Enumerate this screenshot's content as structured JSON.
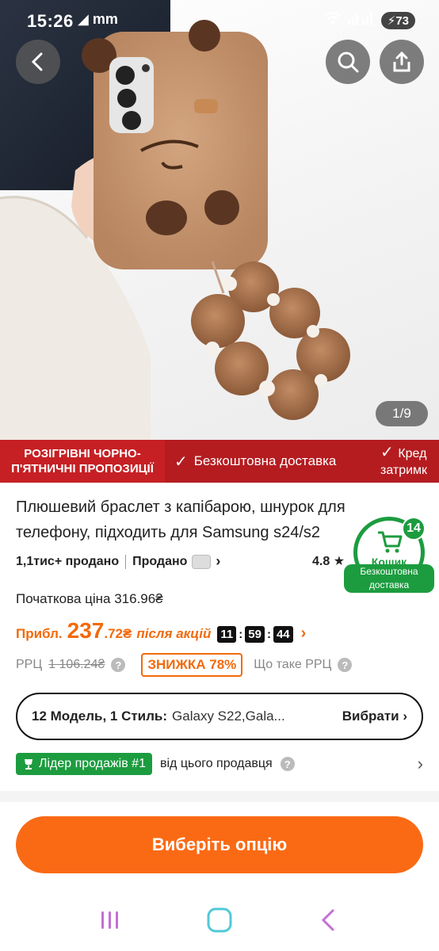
{
  "status_bar": {
    "time": "15:26",
    "system_icons": "◢ mm",
    "battery": "73",
    "battery_prefix": "⚡"
  },
  "gallery": {
    "counter": "1/9"
  },
  "promo": {
    "event_label": "РОЗІГРІВНІ ЧОРНО-П'ЯТНИЧНІ ПРОПОЗИЦІЇ",
    "feature_1": "Безкоштовна доставка",
    "feature_2_line1": "Кред",
    "feature_2_line2": "затримк"
  },
  "product": {
    "title": "Плюшевий браслет з капібарою, шнурок для телефону, підходить для Samsung s24/s2",
    "sold": "1,1тис+ продано",
    "seller_label": "Продано",
    "rating": "4.8",
    "original_price_label": "Початкова ціна",
    "original_price": "316.96₴",
    "approx_label": "Прибл.",
    "price_main": "237",
    "price_fraction": ".72₴",
    "after_promo_label": "після акцій",
    "timer": [
      "11",
      "59",
      "44"
    ],
    "rrp_label": "РРЦ",
    "rrp_value": "1 106.24₴",
    "discount": "ЗНИЖКА 78%",
    "rrp_question": "Що таке РРЦ"
  },
  "cart": {
    "label": "Кошик",
    "count": "14",
    "free_shipping": "Безкоштовна доставка"
  },
  "variant": {
    "label": "12 Модель, 1 Стиль:",
    "value": "Galaxy S22,Gala...",
    "choose": "Вибрати"
  },
  "seller_badge": {
    "label": "Лідер продажів #1",
    "text": "від цього продавця"
  },
  "cta": {
    "label": "Виберіть опцію"
  },
  "colors": {
    "accent_orange": "#fa6a14",
    "price_orange": "#f26a0b",
    "promo_red": "#c62024",
    "green": "#1c9c3f",
    "nav_purple": "#c56fd6",
    "nav_teal": "#4fc9d8"
  },
  "icons": {
    "back": "back-arrow-icon",
    "search": "search-icon",
    "share": "share-icon",
    "cart": "cart-icon",
    "trophy": "trophy-icon",
    "star": "star-icon"
  }
}
